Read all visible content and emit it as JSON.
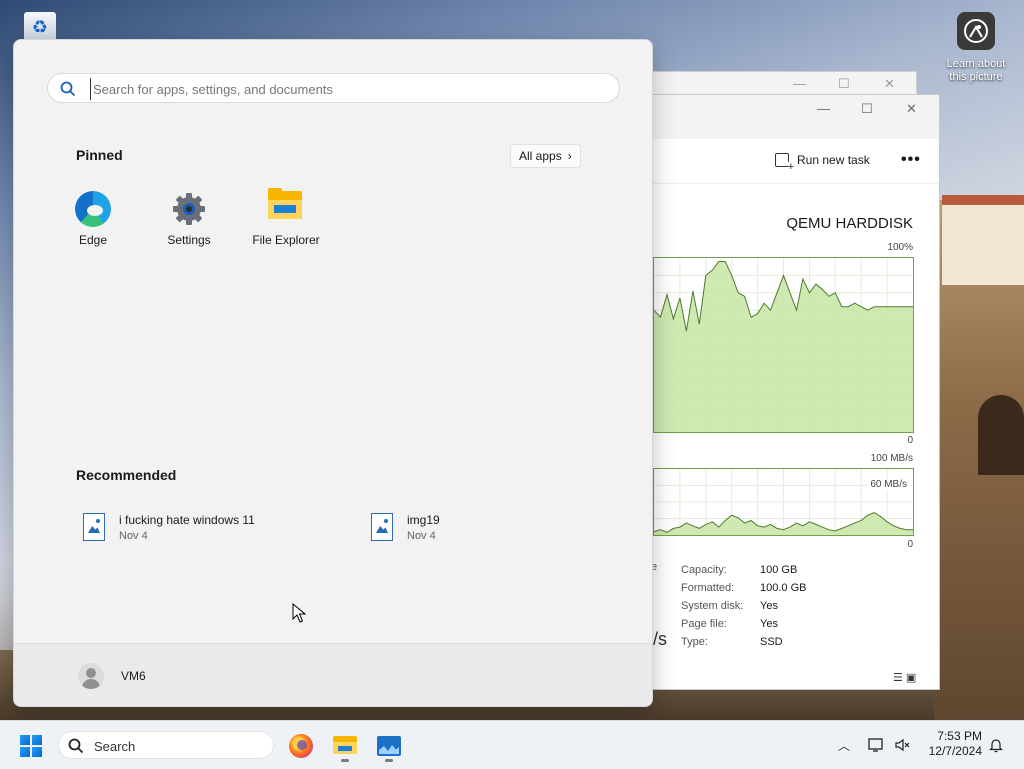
{
  "desktop": {
    "learn_label_line1": "Learn about",
    "learn_label_line2": "this picture"
  },
  "start_menu": {
    "search_placeholder": "Search for apps, settings, and documents",
    "pinned_title": "Pinned",
    "all_apps_label": "All apps",
    "pinned": [
      {
        "label": "Edge",
        "icon": "edge-icon"
      },
      {
        "label": "Settings",
        "icon": "gear-icon"
      },
      {
        "label": "File Explorer",
        "icon": "folder-icon"
      }
    ],
    "recommended_title": "Recommended",
    "recommended": [
      {
        "name": "i fucking hate windows 11",
        "date": "Nov 4",
        "icon": "image-file-icon"
      },
      {
        "name": "img19",
        "date": "Nov 4",
        "icon": "image-file-icon"
      }
    ],
    "user_name": "VM6"
  },
  "task_manager": {
    "run_task_label": "Run new task",
    "more_label": "•••",
    "disk_name": "QEMU HARDDISK",
    "active_time_max": "100%",
    "active_time_min": "0",
    "rate_max": "100 MB/s",
    "rate_mid": "60 MB/s",
    "rate_min": "0",
    "fragment_left": "e",
    "fragment_speed": "/s",
    "stats": [
      {
        "k": "Capacity:",
        "v": "100 GB"
      },
      {
        "k": "Formatted:",
        "v": "100.0 GB"
      },
      {
        "k": "System disk:",
        "v": "Yes"
      },
      {
        "k": "Page file:",
        "v": "Yes"
      },
      {
        "k": "Type:",
        "v": "SSD"
      }
    ],
    "chart_data": [
      {
        "type": "area",
        "ylabel": "",
        "ylim": [
          0,
          100
        ],
        "x": [
          0,
          1,
          2,
          3,
          4,
          5,
          6,
          7,
          8,
          9,
          10,
          11,
          12,
          13,
          14,
          15,
          16,
          17,
          18,
          19,
          20,
          21,
          22,
          23,
          24,
          25,
          26,
          27,
          28,
          29,
          30,
          31,
          32,
          33,
          34,
          35,
          36,
          37,
          38,
          39,
          40
        ],
        "values": [
          70,
          66,
          79,
          65,
          77,
          58,
          81,
          62,
          90,
          93,
          98,
          98,
          90,
          80,
          78,
          66,
          68,
          74,
          70,
          80,
          90,
          80,
          70,
          88,
          80,
          85,
          82,
          78,
          80,
          72,
          72,
          74,
          72,
          70,
          72,
          72,
          72,
          72,
          72,
          72,
          72
        ],
        "color": "#6fa04a"
      },
      {
        "type": "area",
        "ylabel": "",
        "ylim": [
          0,
          100
        ],
        "x": [
          0,
          1,
          2,
          3,
          4,
          5,
          6,
          7,
          8,
          9,
          10,
          11,
          12,
          13,
          14,
          15,
          16,
          17,
          18,
          19,
          20,
          21,
          22,
          23,
          24,
          25,
          26,
          27,
          28,
          29,
          30,
          31,
          32,
          33,
          34,
          35,
          36,
          37,
          38,
          39,
          40
        ],
        "values": [
          5,
          8,
          4,
          10,
          12,
          18,
          14,
          10,
          16,
          20,
          12,
          22,
          30,
          26,
          18,
          22,
          14,
          12,
          16,
          10,
          8,
          12,
          18,
          14,
          20,
          16,
          12,
          8,
          6,
          10,
          14,
          18,
          22,
          30,
          34,
          28,
          20,
          14,
          10,
          8,
          8
        ],
        "color": "#6fa04a"
      }
    ]
  },
  "taskbar": {
    "search_label": "Search",
    "time": "7:53 PM",
    "date": "12/7/2024"
  }
}
